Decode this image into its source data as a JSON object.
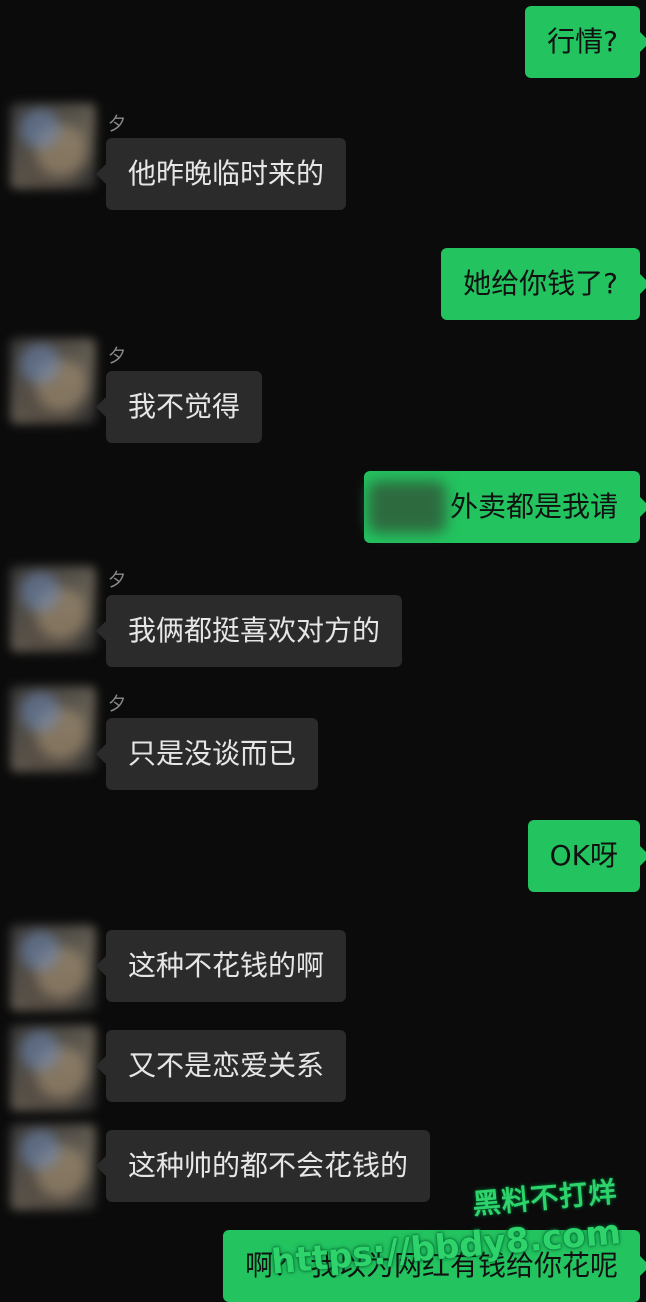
{
  "messages": [
    {
      "id": "m1",
      "side": "out",
      "text": "行情?"
    },
    {
      "id": "m2",
      "side": "in",
      "sender": "夕",
      "text": "他昨晚临时来的"
    },
    {
      "id": "m3",
      "side": "out",
      "text": "她给你钱了?"
    },
    {
      "id": "m4",
      "side": "in",
      "sender": "夕",
      "text": "我不觉得"
    },
    {
      "id": "m5",
      "side": "out",
      "text": "外卖都是我请"
    },
    {
      "id": "m6",
      "side": "in",
      "sender": "夕",
      "text": "我俩都挺喜欢对方的"
    },
    {
      "id": "m7",
      "side": "in",
      "sender": "夕",
      "text": "只是没谈而已"
    },
    {
      "id": "m8",
      "side": "out",
      "text": "OK呀"
    },
    {
      "id": "m9",
      "side": "in",
      "text": "这种不花钱的啊"
    },
    {
      "id": "m10",
      "side": "in",
      "text": "又不是恋爱关系"
    },
    {
      "id": "m11",
      "side": "in",
      "text": "这种帅的都不会花钱的"
    },
    {
      "id": "m12",
      "side": "out",
      "text": "啊？ 我以为网红有钱给你花呢"
    }
  ],
  "watermark": {
    "line1": "黑料不打烊",
    "line2": "https://bbdy8.com"
  },
  "colors": {
    "background": "#0b0b0b",
    "incoming_bubble": "#2b2b2b",
    "outgoing_bubble": "#23c35f",
    "watermark": "#2fd36b"
  }
}
